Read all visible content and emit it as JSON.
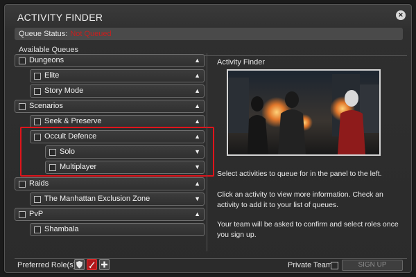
{
  "window": {
    "title": "ACTIVITY FINDER",
    "close_glyph": "×"
  },
  "queue_status": {
    "label": "Queue Status:",
    "value": "Not Queued",
    "value_color": "#c61f1f"
  },
  "available_queues": {
    "label": "Available Queues",
    "items": [
      {
        "name": "queue-dungeons",
        "label": "Dungeons",
        "arrow": "▲"
      },
      {
        "name": "queue-elite",
        "label": "Elite",
        "arrow": "▲"
      },
      {
        "name": "queue-story-mode",
        "label": "Story Mode",
        "arrow": "▲"
      },
      {
        "name": "queue-scenarios",
        "label": "Scenarios",
        "arrow": "▲"
      },
      {
        "name": "queue-seek-and-preserve",
        "label": "Seek & Preserve",
        "arrow": "▲"
      },
      {
        "name": "queue-occult-defence",
        "label": "Occult Defence",
        "arrow": "▲"
      },
      {
        "name": "queue-solo",
        "label": "Solo",
        "arrow": "▼"
      },
      {
        "name": "queue-multiplayer",
        "label": "Multiplayer",
        "arrow": "▼"
      },
      {
        "name": "queue-raids",
        "label": "Raids",
        "arrow": "▲"
      },
      {
        "name": "queue-manhattan-exclusion-zone",
        "label": "The Manhattan Exclusion Zone",
        "arrow": "▼"
      },
      {
        "name": "queue-pvp",
        "label": "PvP",
        "arrow": "▲"
      },
      {
        "name": "queue-shambala",
        "label": "Shambala",
        "arrow": ""
      }
    ]
  },
  "right_panel": {
    "title": "Activity Finder",
    "paragraphs": [
      "Select activities to queue for in the panel to the left.",
      "Click an activity to view more information. Check an activity to add it to your list of queues.",
      "Your team will be asked to confirm and select roles once you sign up."
    ]
  },
  "footer": {
    "preferred_roles_label": "Preferred Role(s):",
    "roles": [
      {
        "name": "tank-role",
        "icon": "shield-icon",
        "active": false
      },
      {
        "name": "dps-role",
        "icon": "sword-icon",
        "active": true
      },
      {
        "name": "healer-role",
        "icon": "plus-icon",
        "active": false
      }
    ],
    "private_team_label": "Private Team:",
    "sign_up_label": "SIGN UP"
  },
  "colors": {
    "accent_red": "#e0141b",
    "background": "#2b2b2b"
  }
}
